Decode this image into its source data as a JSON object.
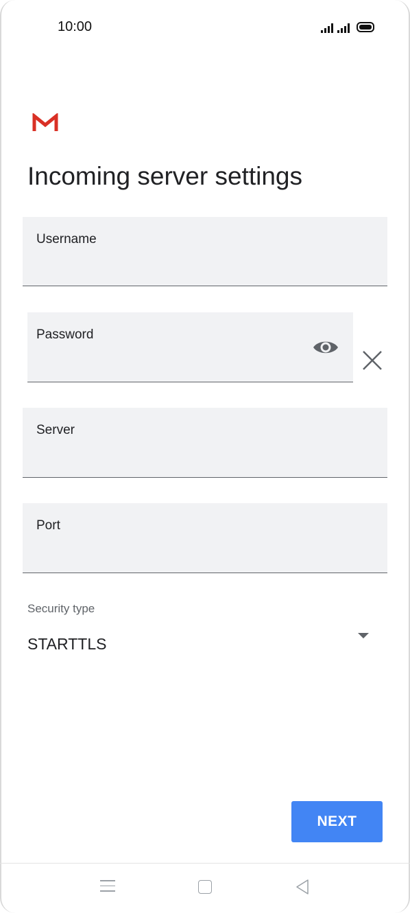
{
  "status_bar": {
    "time": "10:00"
  },
  "header": {
    "title": "Incoming server settings"
  },
  "fields": {
    "username": {
      "label": "Username",
      "value": ""
    },
    "password": {
      "label": "Password",
      "value": ""
    },
    "server": {
      "label": "Server",
      "value": ""
    },
    "port": {
      "label": "Port",
      "value": ""
    }
  },
  "security": {
    "label": "Security type",
    "value": "STARTTLS"
  },
  "actions": {
    "next_label": "NEXT"
  },
  "colors": {
    "accent": "#4285f4",
    "gmail_red": "#d93025",
    "field_bg": "#f1f2f4"
  },
  "icons": [
    "gmail-logo-icon",
    "eye-icon",
    "close-icon",
    "dropdown-arrow-icon",
    "menu-icon",
    "home-icon",
    "back-icon"
  ]
}
